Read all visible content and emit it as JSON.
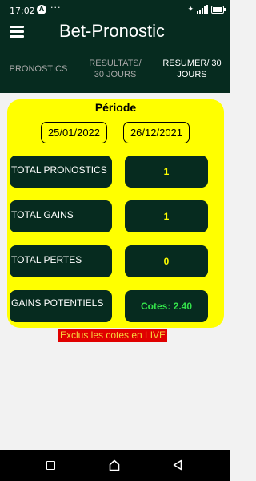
{
  "status_bar": {
    "time": "17:02",
    "notif_icon": "A",
    "overflow": "···"
  },
  "app_bar": {
    "title": "Bet-Pronostic"
  },
  "tabs": [
    {
      "line1": "PRONOSTICS",
      "line2": ""
    },
    {
      "line1": "RESULTATS/",
      "line2": "30 JOURS"
    },
    {
      "line1": "RESUMER/ 30",
      "line2": "JOURS"
    }
  ],
  "card": {
    "periode_label": "Période",
    "date_start": "25/01/2022",
    "date_end": "26/12/2021",
    "rows": [
      {
        "label": "TOTAL PRONOSTICS",
        "value": "1"
      },
      {
        "label": "TOTAL GAINS",
        "value": "1"
      },
      {
        "label": "TOTAL PERTES",
        "value": "0"
      },
      {
        "label": "GAINS POTENTIELS",
        "value": "Cotes:  2.40"
      }
    ]
  },
  "note": "Exclus les cotes en LIVE",
  "colors": {
    "primary_dark": "#062b1f",
    "card_yellow": "#ffff00",
    "value_green": "#33e04a",
    "note_red": "#e00000"
  }
}
